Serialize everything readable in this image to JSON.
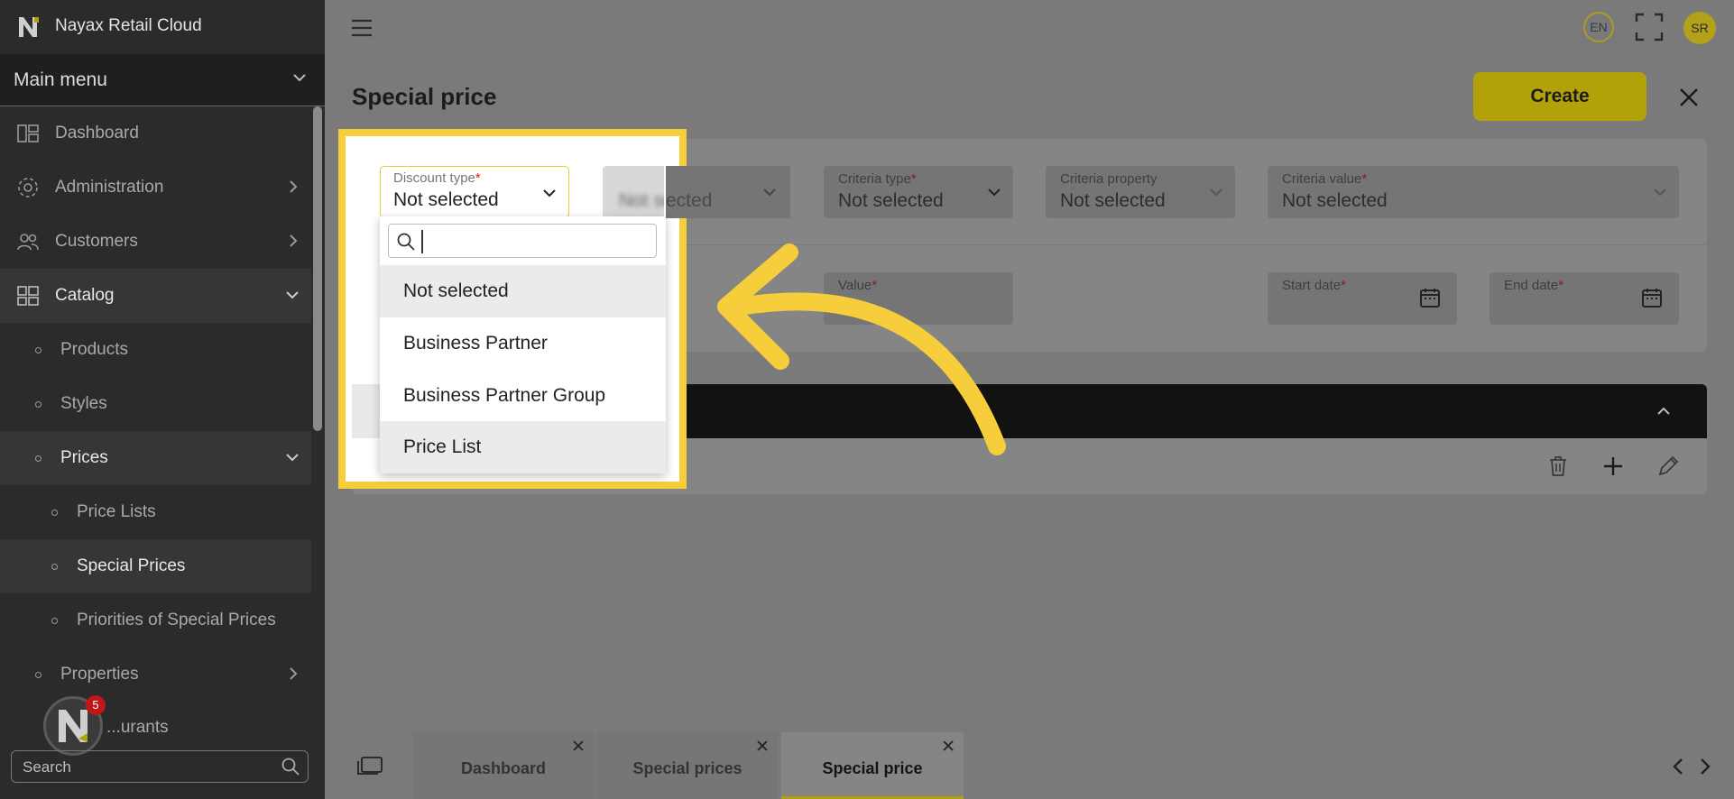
{
  "app": {
    "brand_name": "Nayax Retail Cloud"
  },
  "sidebar": {
    "menu_label": "Main menu",
    "items": [
      {
        "label": "Dashboard",
        "icon": "dashboard-icon"
      },
      {
        "label": "Administration",
        "icon": "gear-icon"
      },
      {
        "label": "Customers",
        "icon": "users-icon"
      },
      {
        "label": "Catalog",
        "icon": "catalog-icon"
      },
      {
        "label": "Products"
      },
      {
        "label": "Styles"
      },
      {
        "label": "Prices"
      },
      {
        "label": "Price Lists"
      },
      {
        "label": "Special Prices"
      },
      {
        "label": "Priorities of Special Prices"
      },
      {
        "label": "Properties"
      },
      {
        "label": "...urants"
      }
    ],
    "search_placeholder": "Search",
    "notification_count": "5"
  },
  "topbar": {
    "language": "EN",
    "user_initials": "SR"
  },
  "page": {
    "title": "Special price",
    "create_label": "Create"
  },
  "filters": {
    "discount_type": {
      "label": "Discount type",
      "req": "*",
      "value": "Not selected"
    },
    "blurred_value": "Not selected",
    "criteria_type": {
      "label": "Criteria type",
      "req": "*",
      "value": "Not selected"
    },
    "criteria_property": {
      "label": "Criteria property",
      "value": "Not selected"
    },
    "criteria_value": {
      "label": "Criteria value",
      "req": "*",
      "value": "Not selected"
    },
    "value": {
      "label": "Value",
      "req": "*"
    },
    "start_date": {
      "label": "Start date",
      "req": "*"
    },
    "end_date": {
      "label": "End date",
      "req": "*"
    }
  },
  "dropdown": {
    "search_value": "",
    "options": [
      "Not selected",
      "Business Partner",
      "Business Partner Group",
      "Price List"
    ]
  },
  "bottom_tabs": [
    {
      "label": "Dashboard"
    },
    {
      "label": "Special prices"
    },
    {
      "label": "Special price"
    }
  ],
  "colors": {
    "accent": "#f6cd3a",
    "brand_yellow": "#e5cc0f",
    "sidebar_bg": "#2b2b2b",
    "header_dark": "#121212"
  }
}
